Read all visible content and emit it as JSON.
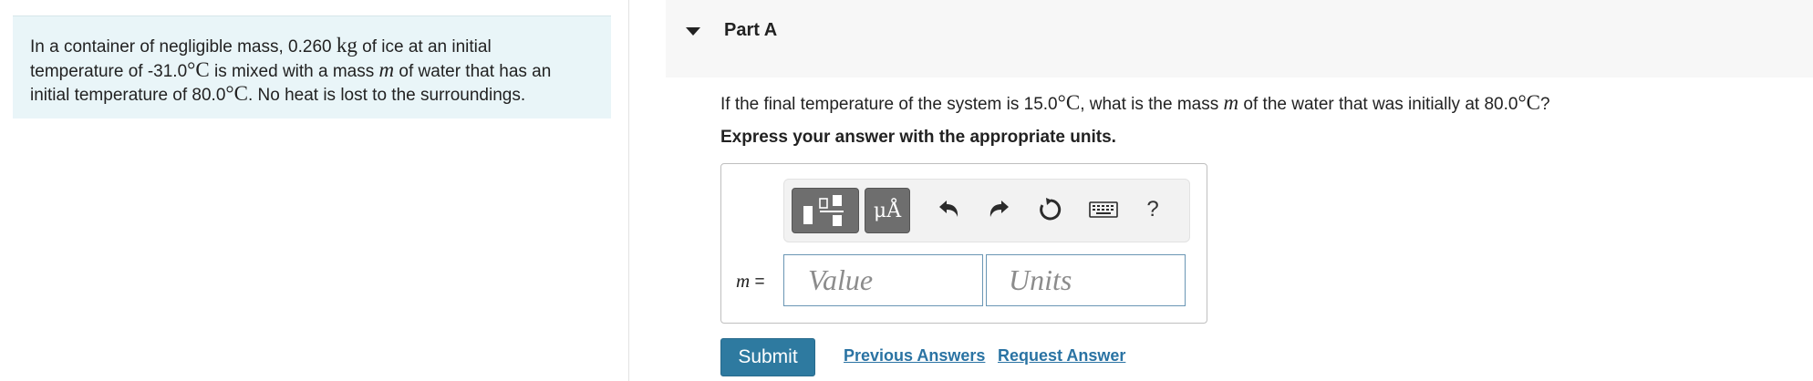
{
  "problem": {
    "t1": "In a container of negligible mass, 0.260 ",
    "u1": "kg",
    "t2": " of ice at an initial",
    "t3": "temperature of -31.0",
    "deg1": "°C",
    "t4": " is mixed with a mass ",
    "m1": "m",
    "t5": " of water that has an",
    "t6": "initial temperature of 80.0",
    "deg2": "°C",
    "t7": ". No heat is lost to the surroundings."
  },
  "part": {
    "title": "Part A",
    "q1": "If the final temperature of the system is 15.0",
    "qdeg1": "°C",
    "q2": ", what is the mass ",
    "qm": "m",
    "q3": " of the water that was initially at 80.0",
    "qdeg2": "°C",
    "q4": "?",
    "instruction": "Express your answer with the appropriate units."
  },
  "answer": {
    "var_symbol": "m",
    "var_eq": " =",
    "value_placeholder": "Value",
    "units_placeholder": "Units",
    "symbols_label": "μÅ",
    "help_label": "?"
  },
  "toolbar_icons": [
    "templates-icon",
    "symbols-icon",
    "undo-icon",
    "redo-icon",
    "reset-icon",
    "keyboard-icon",
    "help-icon"
  ],
  "actions": {
    "submit": "Submit",
    "previous_answers": "Previous Answers",
    "request_answer": "Request Answer"
  },
  "colors": {
    "problem_bg": "#e9f5f8",
    "submit_bg": "#2e7aa0",
    "link": "#2a73a3",
    "input_border": "#6a96b4"
  }
}
